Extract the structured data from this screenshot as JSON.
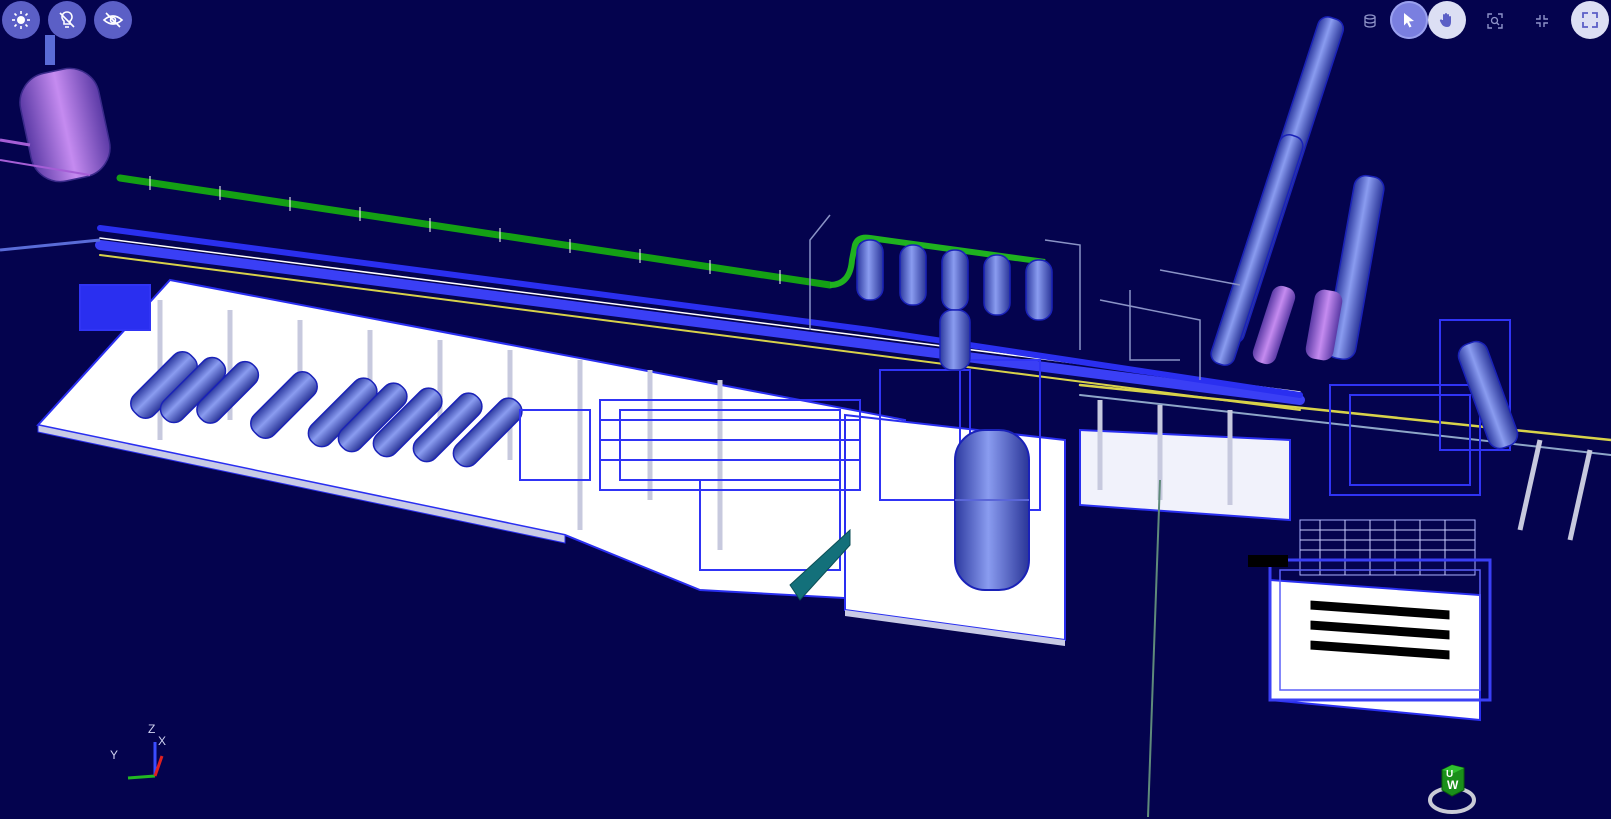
{
  "toolbar_left": {
    "buttons": [
      {
        "name": "lighting-button",
        "icon": "sun-icon"
      },
      {
        "name": "light-off-button",
        "icon": "bulb-off-icon"
      },
      {
        "name": "visibility-button",
        "icon": "eye-off-icon"
      }
    ]
  },
  "toolbar_right": {
    "buttons": [
      {
        "name": "model-tree-button",
        "icon": "layers-icon"
      },
      {
        "name": "select-mode-button",
        "icon": "cursor-icon"
      },
      {
        "name": "pan-mode-button",
        "icon": "hand-icon"
      },
      {
        "name": "zoom-fit-button",
        "icon": "zoom-box-icon"
      },
      {
        "name": "collapse-button",
        "icon": "shrink-icon"
      },
      {
        "name": "fullscreen-button",
        "icon": "expand-icon"
      }
    ]
  },
  "axis_triad": {
    "z_label": "Z",
    "x_label": "X",
    "y_label": "Y"
  },
  "view_cube": {
    "face_label": "W",
    "top_label": "U"
  },
  "colors": {
    "background": "#04034e",
    "platform": "#ffffff",
    "steel": "#2a2ff0",
    "green_pipe": "#1fb21f",
    "yellow_pipe": "#d8d24a",
    "vessel": "#4a5fc8",
    "purple": "#a55ed6"
  }
}
